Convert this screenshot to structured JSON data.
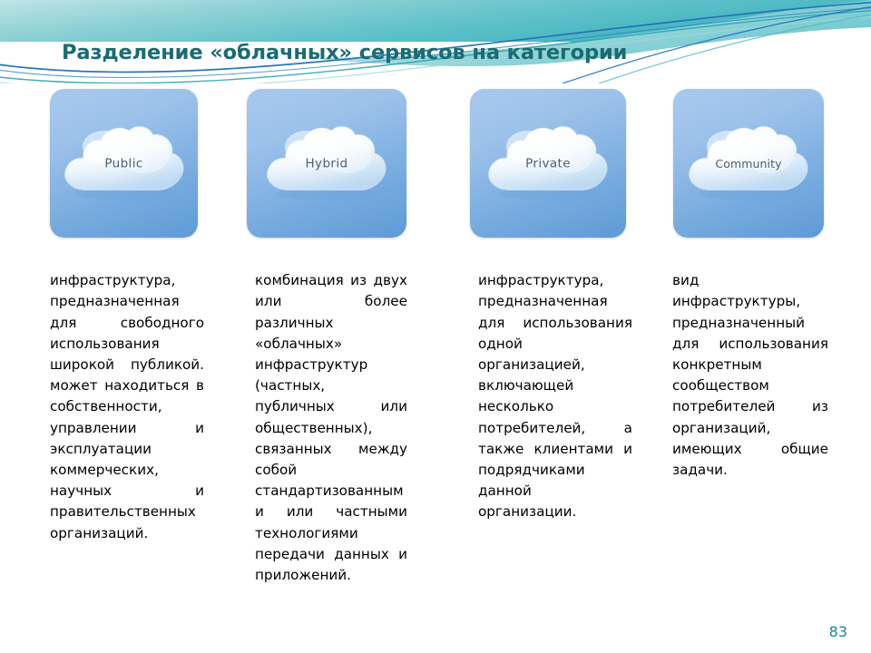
{
  "slide": {
    "title": "Разделение «облачных» сервисов на категории",
    "page_number": "83",
    "title_color": "#1a6b72",
    "page_number_color": "#178a8d",
    "banner_colors": {
      "teal_light": "#9fd7da",
      "teal_mid": "#6ec6cc",
      "teal_deep": "#2aa4b0",
      "blue_line": "#1f6fb5",
      "white": "#ffffff"
    },
    "card_colors": {
      "card_top": "#a8c9ee",
      "card_bottom": "#5e9bd6",
      "cloud_white": "#ffffff",
      "cloud_shade": "#cfe4f7",
      "cloud_label_text": "#4a5d74"
    }
  },
  "categories": [
    {
      "id": "public",
      "cloud_label": "Public",
      "description": "инфраструктура, предназначенная для свободного использования широкой публикой. может находиться в собственности, управлении и эксплуатации коммерческих, научных и правительственных организаций."
    },
    {
      "id": "hybrid",
      "cloud_label": "Hybrid",
      "description": "комбинация из двух или более различных «облачных» инфраструктур (частных, публичных или общественных), связанных между собой стандартизованными или частными технологиями передачи данных и приложений."
    },
    {
      "id": "private",
      "cloud_label": "Private",
      "description": "инфраструктура, предназначенная для использования одной организацией, включающей несколько потребителей, а также клиентами и подрядчиками данной организации."
    },
    {
      "id": "community",
      "cloud_label": "Community",
      "description": "вид инфраструктуры, предназначенный для использования конкретным сообществом потребителей из организаций, имеющих общие задачи."
    }
  ]
}
